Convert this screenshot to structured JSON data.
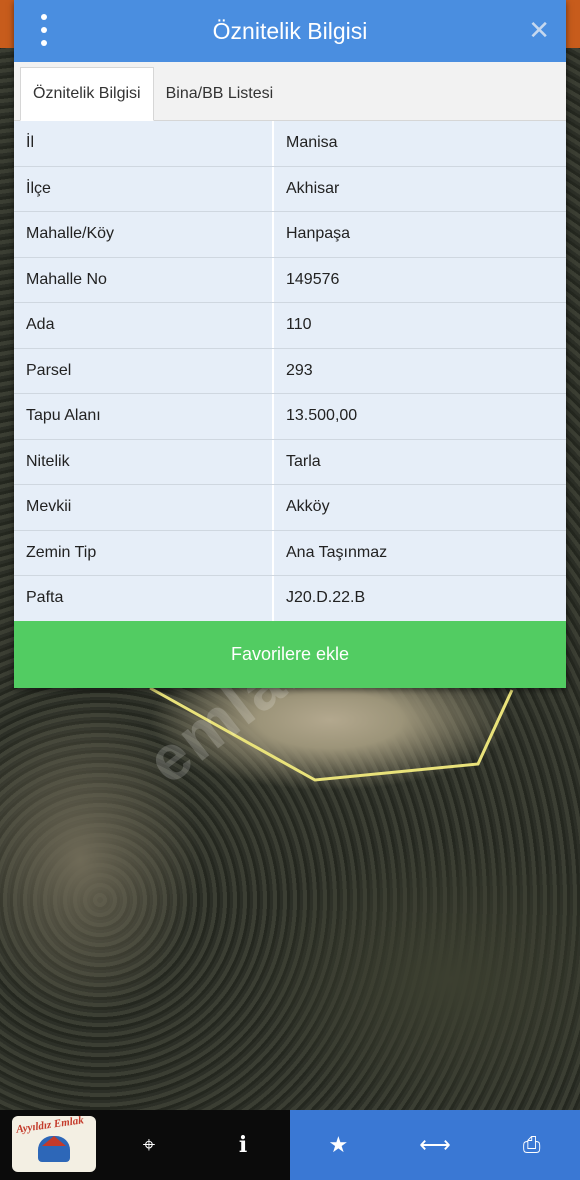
{
  "header": {
    "title": "Öznitelik Bilgisi",
    "close_label": "✕"
  },
  "tabs": [
    {
      "label": "Öznitelik Bilgisi",
      "active": true
    },
    {
      "label": "Bina/BB Listesi",
      "active": false
    }
  ],
  "attributes": [
    {
      "key": "İl",
      "value": "Manisa"
    },
    {
      "key": "İlçe",
      "value": "Akhisar"
    },
    {
      "key": "Mahalle/Köy",
      "value": "Hanpaşa"
    },
    {
      "key": "Mahalle No",
      "value": "149576"
    },
    {
      "key": "Ada",
      "value": "110"
    },
    {
      "key": "Parsel",
      "value": "293"
    },
    {
      "key": "Tapu Alanı",
      "value": "13.500,00"
    },
    {
      "key": "Nitelik",
      "value": "Tarla"
    },
    {
      "key": "Mevkii",
      "value": "Akköy"
    },
    {
      "key": "Zemin Tip",
      "value": "Ana Taşınmaz"
    },
    {
      "key": "Pafta",
      "value": "J20.D.22.B"
    }
  ],
  "favorite_button": "Favorilere ekle",
  "watermark": "emlakjet.com",
  "logo": {
    "text": "Ayyıldız Emlak"
  },
  "toolbar": {
    "icons": [
      "crosshair-icon",
      "info-icon",
      "star-icon",
      "arrows-horizontal-icon",
      "printer-icon"
    ],
    "glyphs": {
      "crosshair": "⌖",
      "info": "i",
      "star": "★",
      "arrows": "⟷",
      "print": "⎙"
    }
  },
  "colors": {
    "header": "#4a8ee0",
    "favorite": "#52cc62",
    "toolbar_right": "#3a78d4"
  }
}
